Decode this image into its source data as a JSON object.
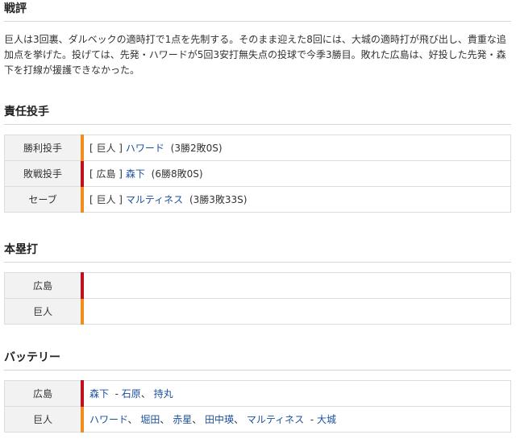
{
  "review": {
    "title": "戦評",
    "text": "巨人は3回裏、ダルベックの適時打で1点を先制する。そのまま迎えた8回には、大城の適時打が飛び出し、貴重な追加点を挙げた。投げては、先発・ハワードが5回3安打無失点の投球で今季3勝目。敗れた広島は、好投した先発・森下を打線が援護できなかった。"
  },
  "pitchers": {
    "title": "責任投手",
    "rows": [
      {
        "label": "勝利投手",
        "team": "[ 巨人 ]",
        "team_key": "giants",
        "player": "ハワード",
        "record": "(3勝2敗0S)"
      },
      {
        "label": "敗戦投手",
        "team": "[ 広島 ]",
        "team_key": "carp",
        "player": "森下",
        "record": "(6勝8敗0S)"
      },
      {
        "label": "セーブ",
        "team": "[ 巨人 ]",
        "team_key": "giants",
        "player": "マルティネス",
        "record": "(3勝3敗33S)"
      }
    ]
  },
  "home_runs": {
    "title": "本塁打",
    "rows": [
      {
        "team": "広島",
        "team_key": "carp",
        "value": ""
      },
      {
        "team": "巨人",
        "team_key": "giants",
        "value": ""
      }
    ]
  },
  "battery": {
    "title": "バッテリー",
    "rows": [
      {
        "team": "広島",
        "team_key": "carp",
        "pitchers": [
          "森下"
        ],
        "catchers": [
          "石原",
          "持丸"
        ]
      },
      {
        "team": "巨人",
        "team_key": "giants",
        "pitchers": [
          "ハワード",
          "堀田",
          "赤星",
          "田中瑛",
          "マルティネス"
        ],
        "catchers": [
          "大城"
        ]
      }
    ]
  },
  "colors": {
    "giants": "#f08e1d",
    "carp": "#c1101d",
    "link": "#1a4f9c",
    "label_bg": "#f2f2f2"
  }
}
